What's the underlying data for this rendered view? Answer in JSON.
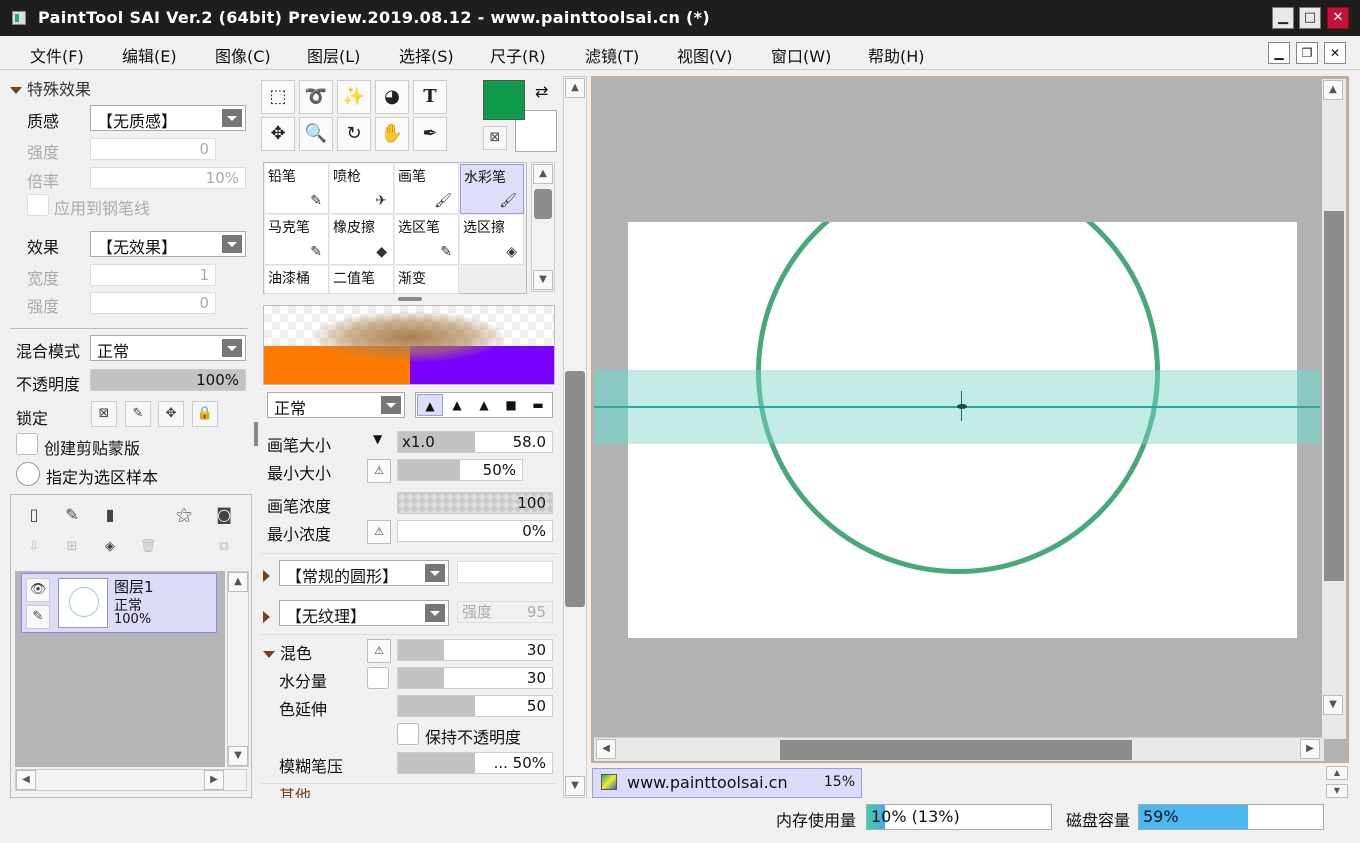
{
  "window": {
    "title": "PaintTool SAI Ver.2 (64bit) Preview.2019.08.12 - www.painttoolsai.cn (*)",
    "minimize": "▁",
    "maximize": "□",
    "close": "✕"
  },
  "menu": [
    "文件(F)",
    "编辑(E)",
    "图像(C)",
    "图层(L)",
    "选择(S)",
    "尺子(R)",
    "滤镜(T)",
    "视图(V)",
    "窗口(W)",
    "帮助(H)"
  ],
  "mdi": {
    "minimize": "▁",
    "restore": "❐",
    "close": "✕"
  },
  "effects": {
    "header": "特殊效果",
    "texture_label": "质感",
    "texture_value": "【无质感】",
    "strength_label": "强度",
    "strength_value": "0",
    "scale_label": "倍率",
    "scale_value": "10%",
    "apply_pen_label": "应用到钢笔线",
    "effect_label": "效果",
    "effect_value": "【无效果】",
    "width_label": "宽度",
    "width_value": "1",
    "strength2_label": "强度",
    "strength2_value": "0"
  },
  "layer_props": {
    "blend_label": "混合模式",
    "blend_value": "正常",
    "opacity_label": "不透明度",
    "opacity_value": "100%",
    "opacity_fraction": 1.0,
    "lock_label": "锁定",
    "clip_label": "创建剪贴蒙版",
    "sample_label": "指定为选区样本"
  },
  "layers": [
    {
      "name": "图层1",
      "mode": "正常",
      "opacity": "100%"
    }
  ],
  "colors": {
    "primary": "#0e9a4a",
    "secondary": "#ffffff",
    "brush_selected": "#dedefa",
    "circle": "#0a8c4b",
    "band": "#78d2c8"
  },
  "brushes": [
    {
      "label": "铅笔",
      "icon": "✎"
    },
    {
      "label": "喷枪",
      "icon": "✈"
    },
    {
      "label": "画笔",
      "icon": "🖌"
    },
    {
      "label": "水彩笔",
      "icon": "🖌",
      "selected": true
    },
    {
      "label": "马克笔",
      "icon": "✎"
    },
    {
      "label": "橡皮擦",
      "icon": "◆"
    },
    {
      "label": "选区笔",
      "icon": "✎"
    },
    {
      "label": "选区擦",
      "icon": "◈"
    },
    {
      "label": "油漆桶",
      "icon": ""
    },
    {
      "label": "二值笔",
      "icon": ""
    },
    {
      "label": "渐变",
      "icon": ""
    }
  ],
  "brush_settings": {
    "mode_value": "正常",
    "size_label": "画笔大小",
    "size_multiplier": "x1.0",
    "size_value": "58.0",
    "size_fraction": 0.5,
    "min_size_label": "最小大小",
    "min_size_value": "50%",
    "min_size_fraction": 0.5,
    "density_label": "画笔浓度",
    "density_value": "100",
    "min_density_label": "最小浓度",
    "min_density_value": "0%",
    "shape_value": "【常规的圆形】",
    "texture_value": "【无纹理】",
    "texture_strength_label": "强度",
    "texture_strength_value": "95",
    "blend_label": "混色",
    "blend_value": "30",
    "blend_fraction": 0.3,
    "water_label": "水分量",
    "water_value": "30",
    "water_fraction": 0.3,
    "stretch_label": "色延伸",
    "stretch_value": "50",
    "stretch_fraction": 0.5,
    "keep_opacity_label": "保持不透明度",
    "blur_label": "模糊笔压",
    "blur_value": "... 50%",
    "blur_fraction": 0.5,
    "more_label": "其他"
  },
  "document": {
    "tab_name": "www.painttoolsai.cn",
    "zoom": "15%"
  },
  "status": {
    "memory_label": "内存使用量",
    "memory_value": "10% (13%)",
    "memory_fraction": 0.1,
    "disk_label": "磁盘容量",
    "disk_value": "59%",
    "disk_fraction": 0.59
  }
}
